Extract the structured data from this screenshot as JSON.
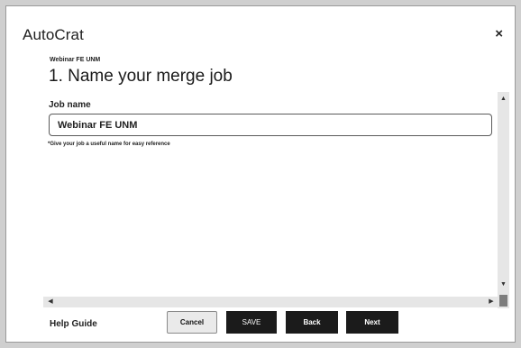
{
  "dialog": {
    "app_title": "AutoCrat",
    "close_glyph": "×"
  },
  "step": {
    "job_title_small": "Webinar FE UNM",
    "title": "1. Name your merge job"
  },
  "form": {
    "job_name_label": "Job name",
    "job_name_value": "Webinar FE UNM",
    "hint": "*Give your job a useful name for easy reference"
  },
  "scrollbars": {
    "up_glyph": "▲",
    "down_glyph": "▼",
    "left_glyph": "◀",
    "right_glyph": "▶"
  },
  "footer": {
    "help_label": "Help Guide",
    "cancel_label": "Cancel",
    "save_label": "SAVE",
    "back_label": "Back",
    "next_label": "Next"
  },
  "icons": {
    "close": "close-icon",
    "scroll_up": "scroll-up-icon",
    "scroll_down": "scroll-down-icon",
    "scroll_left": "scroll-left-icon",
    "scroll_right": "scroll-right-icon"
  }
}
